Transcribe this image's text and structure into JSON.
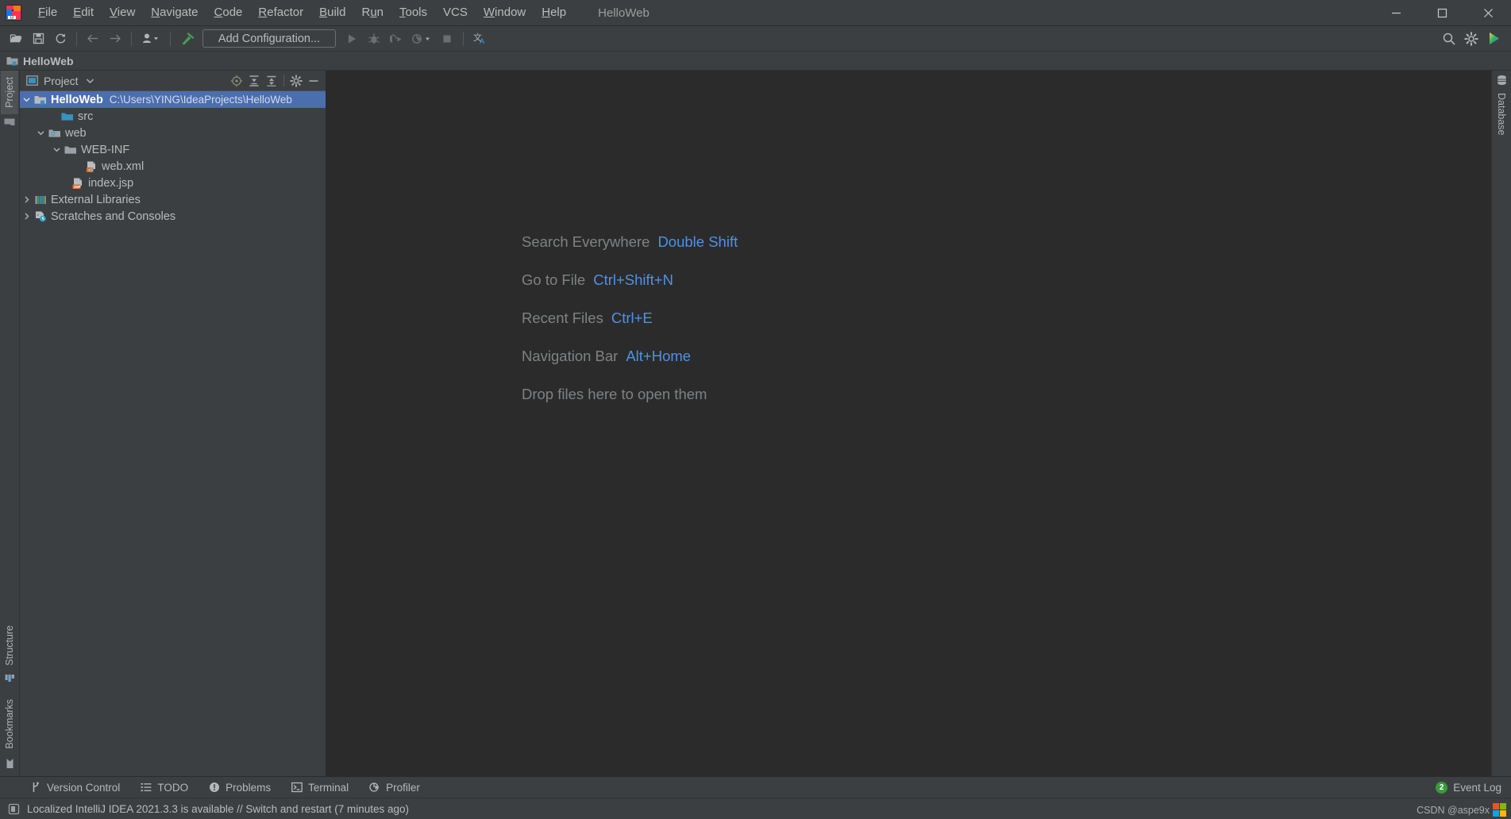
{
  "window": {
    "title": "HelloWeb",
    "app_icon": "intellij-idea-logo",
    "controls": {
      "minimize": "—",
      "maximize": "☐",
      "close": "✕"
    }
  },
  "menubar": {
    "items": [
      {
        "label": "File",
        "mnemonic": "F"
      },
      {
        "label": "Edit",
        "mnemonic": "E"
      },
      {
        "label": "View",
        "mnemonic": "V"
      },
      {
        "label": "Navigate",
        "mnemonic": "N"
      },
      {
        "label": "Code",
        "mnemonic": "C"
      },
      {
        "label": "Refactor",
        "mnemonic": "R"
      },
      {
        "label": "Build",
        "mnemonic": "B"
      },
      {
        "label": "Run",
        "mnemonic": "u"
      },
      {
        "label": "Tools",
        "mnemonic": "T"
      },
      {
        "label": "VCS",
        "mnemonic": ""
      },
      {
        "label": "Window",
        "mnemonic": "W"
      },
      {
        "label": "Help",
        "mnemonic": "H"
      }
    ]
  },
  "toolbar": {
    "open_icon": "open-folder-icon",
    "save_icon": "save-all-icon",
    "sync_icon": "reload-from-disk-icon",
    "back_icon": "navigate-back-icon",
    "forward_icon": "navigate-forward-icon",
    "profile_icon": "user-profile-icon",
    "build_icon": "build-hammer-icon",
    "run_config_label": "Add Configuration...",
    "run_icon": "run-icon",
    "debug_icon": "debug-icon",
    "run_with_coverage_icon": "run-with-coverage-icon",
    "profile_run_icon": "profile-run-icon",
    "stop_icon": "stop-icon",
    "translate_icon": "translate-icon",
    "search_icon": "search-everywhere-icon",
    "settings_icon": "settings-gear-icon",
    "updates_icon": "ide-updates-icon"
  },
  "navbar": {
    "crumb": "HelloWeb",
    "icon": "module-folder-icon"
  },
  "left_stripe": {
    "tabs": [
      {
        "label": "Project",
        "selected": true,
        "icon": "project-tool-icon"
      },
      {
        "label": "Structure",
        "selected": false,
        "icon": "structure-tool-icon"
      },
      {
        "label": "Bookmarks",
        "selected": false,
        "icon": "bookmarks-tool-icon"
      }
    ]
  },
  "right_stripe": {
    "tabs": [
      {
        "label": "Database",
        "selected": false,
        "icon": "database-tool-icon"
      }
    ]
  },
  "project_panel": {
    "title": "Project",
    "dropdown_icon": "chevron-down-icon",
    "view_icon": "project-view-icon",
    "actions": [
      {
        "name": "scroll-from-source-icon",
        "label": "Select Opened File"
      },
      {
        "name": "expand-all-icon",
        "label": "Expand All"
      },
      {
        "name": "collapse-all-icon",
        "label": "Collapse All"
      },
      {
        "name": "settings-gear-icon",
        "label": "Options"
      },
      {
        "name": "hide-icon",
        "label": "Hide"
      }
    ],
    "tree": [
      {
        "label": "HelloWeb",
        "path": "C:\\Users\\YING\\IdeaProjects\\HelloWeb",
        "depth": 0,
        "expanded": true,
        "selected": true,
        "icon": "module-folder-icon",
        "bold": true
      },
      {
        "label": "src",
        "path": "",
        "depth": 2,
        "expanded": null,
        "selected": false,
        "icon": "source-folder-icon",
        "bold": false
      },
      {
        "label": "web",
        "path": "",
        "depth": 1,
        "expanded": true,
        "selected": false,
        "icon": "web-resource-folder-icon",
        "bold": false
      },
      {
        "label": "WEB-INF",
        "path": "",
        "depth": 2,
        "expanded": true,
        "selected": false,
        "icon": "folder-icon",
        "bold": false
      },
      {
        "label": "web.xml",
        "path": "",
        "depth": 4,
        "expanded": null,
        "selected": false,
        "icon": "xml-file-icon",
        "bold": false
      },
      {
        "label": "index.jsp",
        "path": "",
        "depth": 3,
        "expanded": null,
        "selected": false,
        "icon": "jsp-file-icon",
        "bold": false
      },
      {
        "label": "External Libraries",
        "path": "",
        "depth": 0,
        "expanded": false,
        "selected": false,
        "icon": "libraries-icon",
        "bold": false
      },
      {
        "label": "Scratches and Consoles",
        "path": "",
        "depth": 0,
        "expanded": false,
        "selected": false,
        "icon": "scratches-icon",
        "bold": false
      }
    ]
  },
  "editor": {
    "hints": [
      {
        "action": "Search Everywhere",
        "shortcut": "Double Shift"
      },
      {
        "action": "Go to File",
        "shortcut": "Ctrl+Shift+N"
      },
      {
        "action": "Recent Files",
        "shortcut": "Ctrl+E"
      },
      {
        "action": "Navigation Bar",
        "shortcut": "Alt+Home"
      }
    ],
    "drop_hint": "Drop files here to open them"
  },
  "bottom_bar": {
    "items": [
      {
        "label": "Version Control",
        "icon": "vcs-branch-icon"
      },
      {
        "label": "TODO",
        "icon": "todo-list-icon"
      },
      {
        "label": "Problems",
        "icon": "problems-warning-icon"
      },
      {
        "label": "Terminal",
        "icon": "terminal-icon"
      },
      {
        "label": "Profiler",
        "icon": "profiler-icon"
      }
    ],
    "event_log": {
      "label": "Event Log",
      "count": "2"
    }
  },
  "statusbar": {
    "icon": "notification-icon",
    "message": "Localized IntelliJ IDEA 2021.3.3 is available // Switch and restart (7 minutes ago)",
    "watermark": "CSDN @aspe9x"
  },
  "colors": {
    "selection_blue": "#4b6eaf",
    "accent_link": "#4f91e5",
    "panel_bg": "#3c3f41",
    "editor_bg": "#2b2b2b",
    "text": "#bbbbbb",
    "folder_blue": "#5a9fd4",
    "green": "#499c54",
    "orange": "#cf6a38"
  }
}
